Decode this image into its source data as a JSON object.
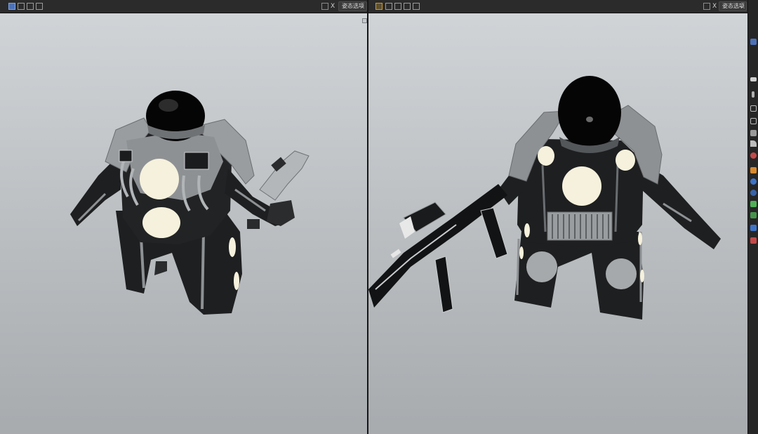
{
  "left_viewport": {
    "mode_dropdown": "姿态选项",
    "x_toggle": "X",
    "header_icons": [
      "select-box-icon",
      "select-extend-icon",
      "select-subtract-icon",
      "select-invert-icon"
    ]
  },
  "right_viewport": {
    "mode_dropdown": "姿态选项",
    "x_toggle": "X",
    "header_icons": [
      "tweak-tool-icon",
      "select-box-icon",
      "select-extend-icon",
      "select-subtract-icon",
      "select-invert-icon"
    ]
  },
  "toolbar": {
    "icons": [
      "view-icon",
      "cursor-icon",
      "move-icon",
      "rotate-icon",
      "scale-icon",
      "transform-icon",
      "annotate-icon",
      "measure-icon",
      "shading-icon",
      "camera-icon",
      "render-icon",
      "object-icon",
      "modifier-icon",
      "particles-icon",
      "physics-icon",
      "constraint-icon",
      "data-icon",
      "material-icon"
    ]
  },
  "colors": {
    "viewport_bg_top": "#d0d4d7",
    "viewport_bg_bottom": "#a7abae",
    "header_bg": "#2b2b2b",
    "suit_dark": "#1e1f20",
    "suit_gray": "#8e9194",
    "light_panel": "#f5f1dc",
    "accent_blue": "#4d72b8"
  }
}
